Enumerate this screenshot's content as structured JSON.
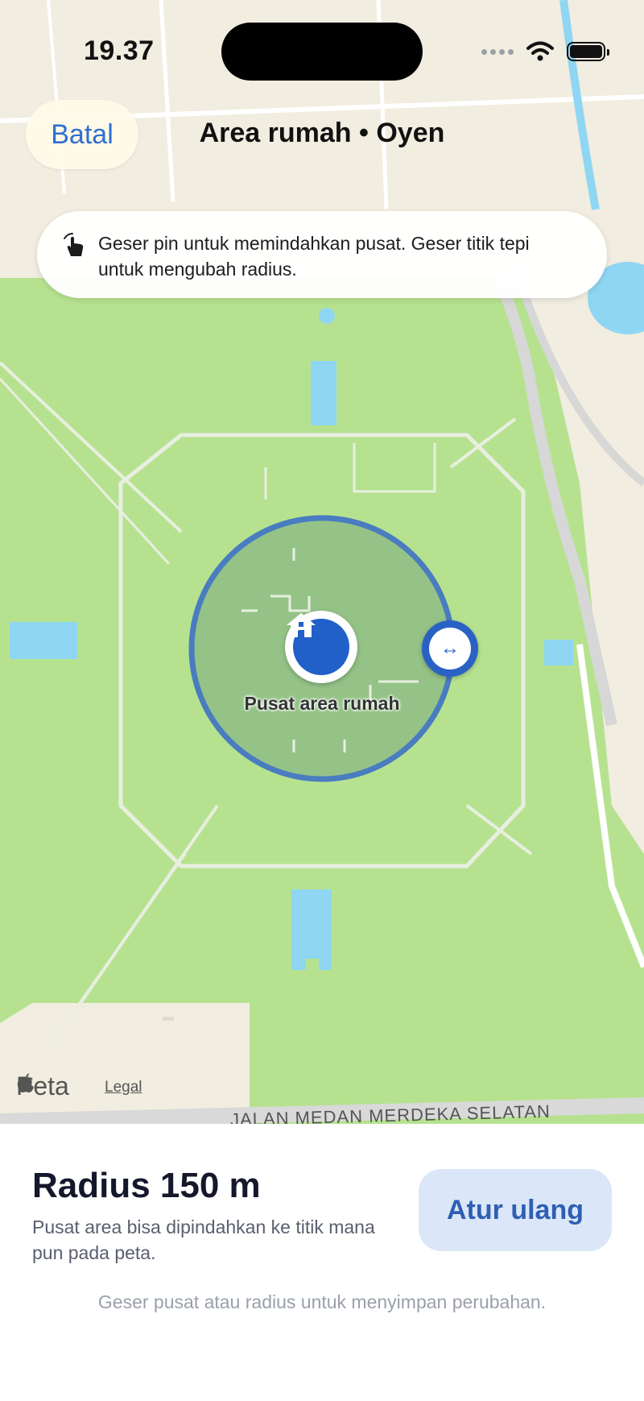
{
  "status": {
    "time": "19.37"
  },
  "header": {
    "cancel_label": "Batal",
    "title": "Area rumah • Oyen"
  },
  "hint": {
    "text": "Geser pin untuk memindahkan pusat. Geser titik tepi untuk mengubah radius."
  },
  "map": {
    "center_label": "Pusat area rumah",
    "handle_glyph": "↔",
    "brand": "Peta",
    "legal": "Legal",
    "street": "JALAN MEDAN MERDEKA SELATAN"
  },
  "sheet": {
    "radius_text": "Radius 150 m",
    "description": "Pusat area bisa dipindahkan ke titik mana pun pada peta.",
    "reset_label": "Atur ulang",
    "footnote": "Geser pusat atau radius untuk menyimpan perubahan."
  },
  "colors": {
    "accent": "#2060c8",
    "park": "#b6e290",
    "water": "#8fd6f2",
    "land": "#f0ecdd",
    "reset_bg": "#dbe7f8"
  },
  "icons": [
    "hand-drag-icon",
    "house-icon",
    "resize-arrows-icon",
    "apple-logo-icon",
    "wifi-icon",
    "battery-icon"
  ]
}
